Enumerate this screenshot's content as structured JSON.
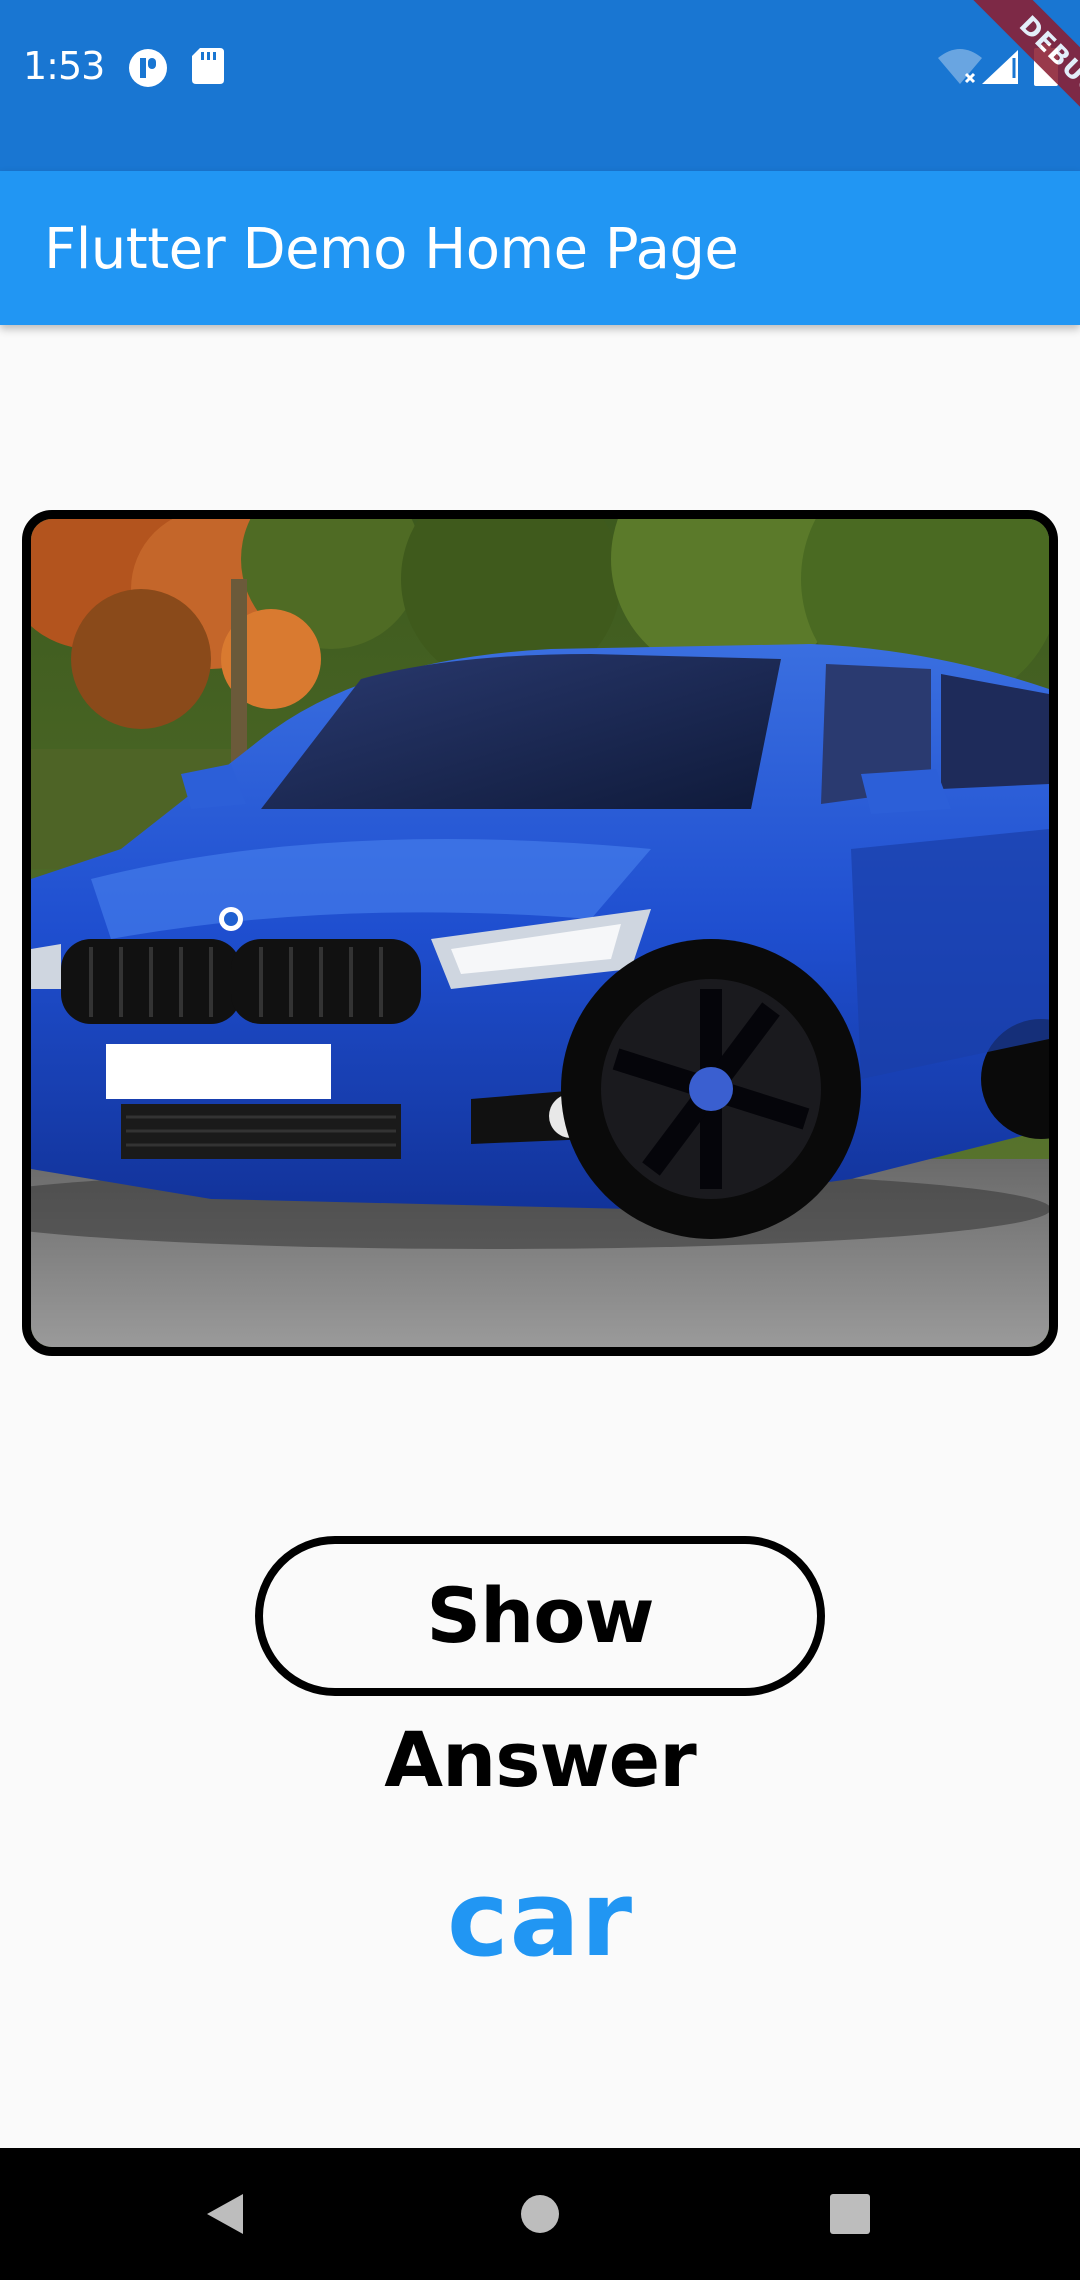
{
  "status_bar": {
    "time": "1:53",
    "icons": [
      "p-badge-icon",
      "sd-card-icon",
      "wifi-off-icon",
      "signal-icon",
      "battery-icon"
    ],
    "color": "#1976d2"
  },
  "debug_banner": {
    "label": "DEBUG"
  },
  "app_bar": {
    "title": "Flutter Demo Home Page",
    "color": "#2196f3"
  },
  "card": {
    "image_subject": "blue car",
    "border_color": "#000000"
  },
  "button": {
    "label": "Show Answer"
  },
  "answer": {
    "text": "car",
    "color": "#2196f3"
  },
  "nav_bar": {
    "icons": [
      "back-icon",
      "home-icon",
      "recents-icon"
    ]
  }
}
